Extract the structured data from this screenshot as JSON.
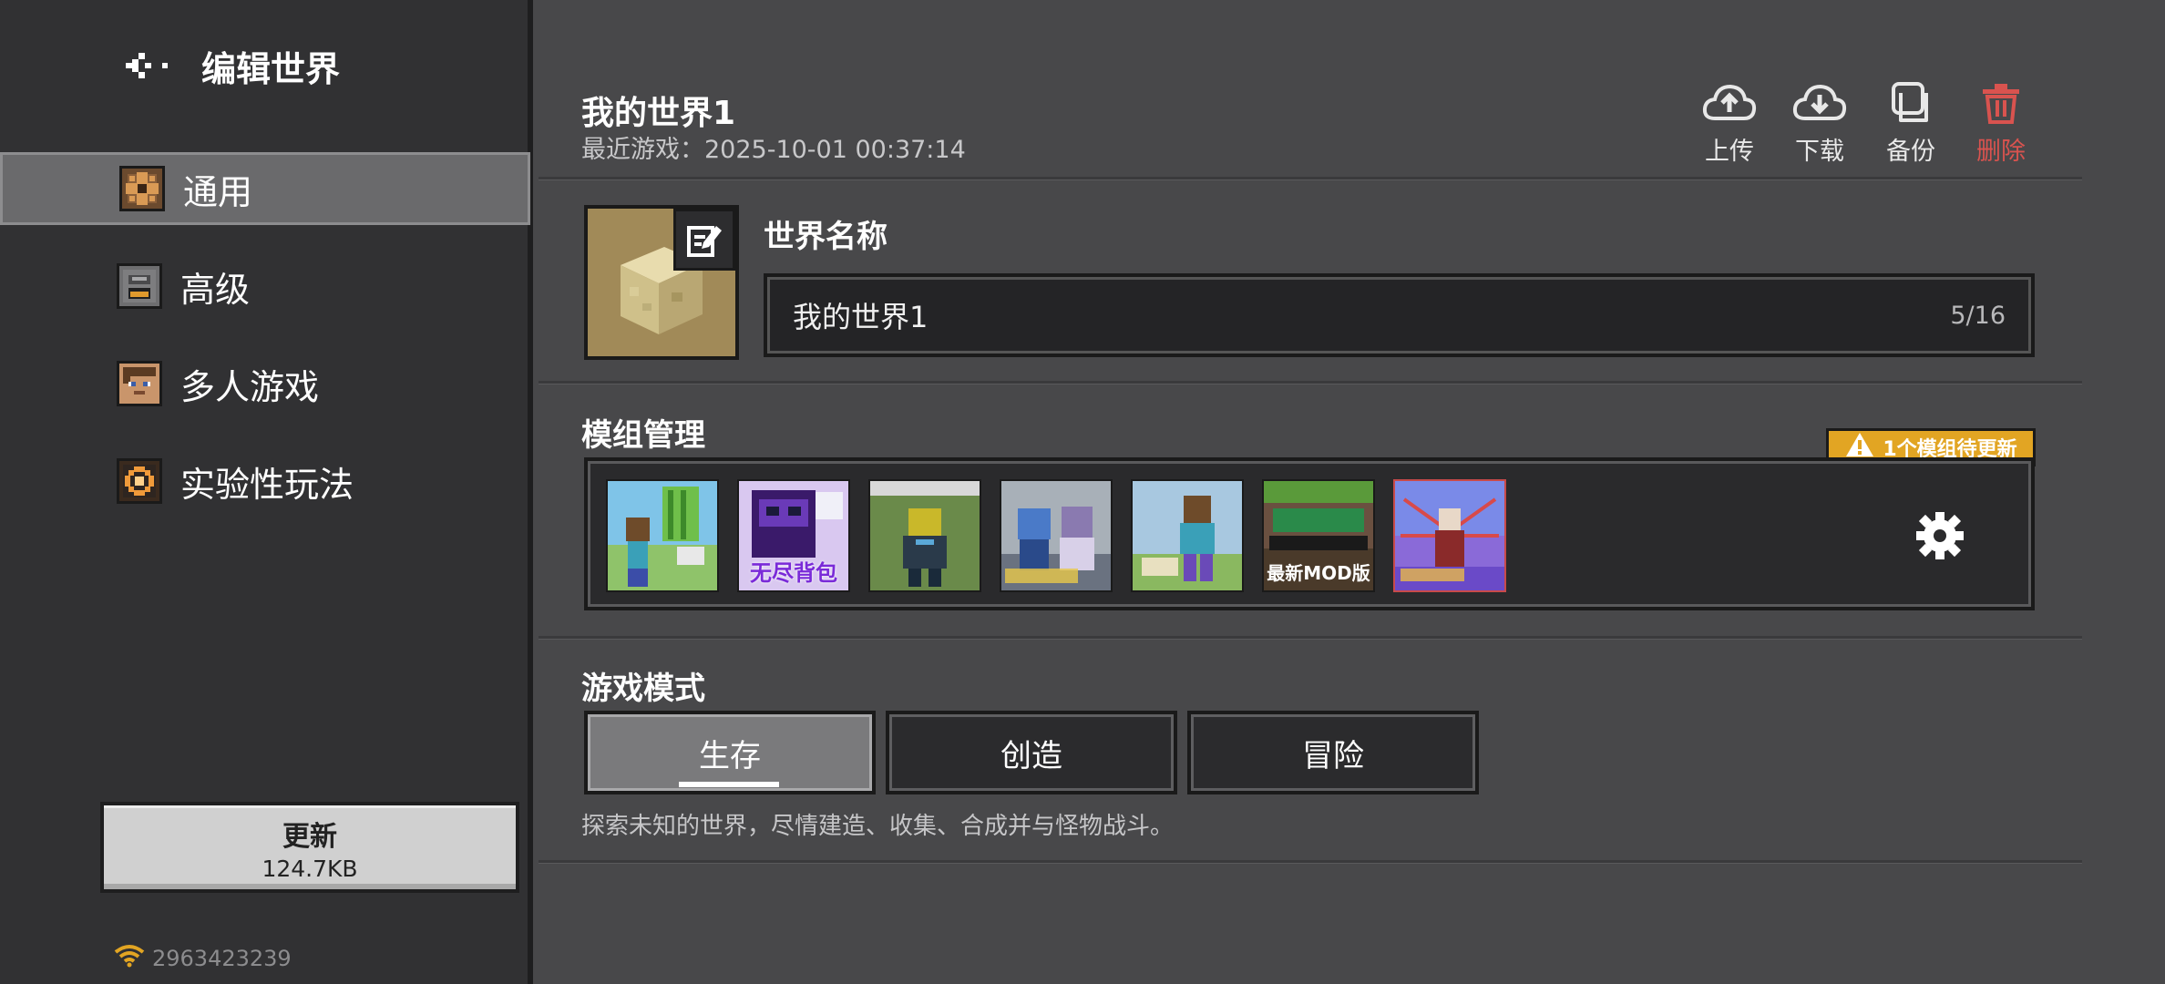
{
  "sidebar": {
    "title": "编辑世界",
    "items": [
      {
        "label": "通用",
        "icon": "gear-block-icon",
        "active": true
      },
      {
        "label": "高级",
        "icon": "furnace-icon",
        "active": false
      },
      {
        "label": "多人游戏",
        "icon": "player-face-icon",
        "active": false
      },
      {
        "label": "实验性玩法",
        "icon": "experimental-icon",
        "active": false
      }
    ],
    "update": {
      "label": "更新",
      "size": "124.7KB"
    },
    "account_id": "2963423239"
  },
  "world": {
    "title": "我的世界1",
    "last_played": "最近游戏：2025-10-01 00:37:14"
  },
  "actions": {
    "upload": "上传",
    "download": "下载",
    "backup": "备份",
    "delete": "删除"
  },
  "world_name": {
    "label": "世界名称",
    "value": "我的世界1",
    "count": "5/16"
  },
  "mods": {
    "label": "模组管理",
    "warning": "1个模组待更新",
    "items": [
      {
        "caption": ""
      },
      {
        "caption": "无尽背包"
      },
      {
        "caption": ""
      },
      {
        "caption": ""
      },
      {
        "caption": ""
      },
      {
        "caption": "最新MOD版"
      },
      {
        "caption": ""
      }
    ]
  },
  "game_mode": {
    "label": "游戏模式",
    "options": [
      "生存",
      "创造",
      "冒险"
    ],
    "selected": "生存",
    "description": "探索未知的世界，尽情建造、收集、合成并与怪物战斗。"
  },
  "colors": {
    "accent_warning": "#e2a523",
    "danger": "#d9534f"
  }
}
